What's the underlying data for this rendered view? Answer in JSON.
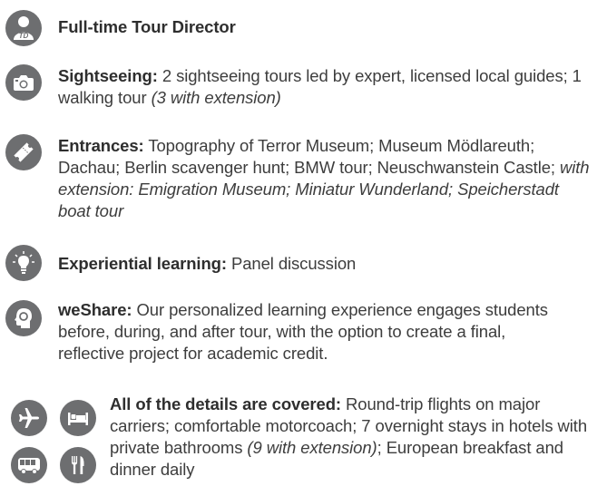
{
  "items": [
    {
      "id": "tour-director",
      "icon": "tour-director-icon",
      "bold": "Full-time Tour Director",
      "parts": []
    },
    {
      "id": "sightseeing",
      "icon": "camera-icon",
      "bold": "Sightseeing:",
      "parts": [
        {
          "t": " 2 sightseeing tours led by expert, licensed local guides; 1 walking tour ",
          "i": false
        },
        {
          "t": "(3 with extension)",
          "i": true
        }
      ]
    },
    {
      "id": "entrances",
      "icon": "ticket-icon",
      "bold": "Entrances:",
      "parts": [
        {
          "t": " Topography of Terror Museum; Museum Mödlareuth; Dachau; Berlin scavenger hunt; BMW tour; Neuschwanstein Castle; ",
          "i": false
        },
        {
          "t": "with extension: Emigration Museum; Miniatur Wunderland; Speicherstadt boat tour",
          "i": true
        }
      ]
    },
    {
      "id": "experiential",
      "icon": "lightbulb-icon",
      "bold": "Experiential learning:",
      "parts": [
        {
          "t": " Panel discussion",
          "i": false
        }
      ]
    },
    {
      "id": "weshare",
      "icon": "head-icon",
      "bold": "weShare:",
      "parts": [
        {
          "t": " Our personalized learning experience engages students before, during, and after tour, with the option to create a final, reflective project for academic credit.",
          "i": false
        }
      ]
    },
    {
      "id": "details",
      "icon": "travel-icons",
      "bold": "All of the details are covered:",
      "parts": [
        {
          "t": " Round-trip flights on major carriers; comfortable motorcoach; 7 overnight stays in hotels with private bathrooms ",
          "i": false
        },
        {
          "t": "(9 with extension)",
          "i": true
        },
        {
          "t": "; European breakfast and dinner daily",
          "i": false
        }
      ]
    }
  ]
}
